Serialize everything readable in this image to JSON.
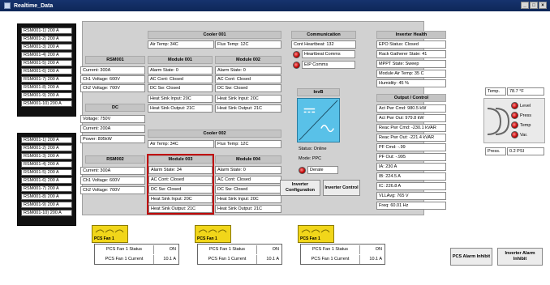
{
  "window": {
    "title": "Realtime_Data",
    "minimize": "_",
    "maximize": "□",
    "close": "×"
  },
  "rsm_group_a": [
    "RSM001-1)  200 A",
    "RSM001-2)  200 A",
    "RSM001-3)  200 A",
    "RSM001-4)  200 A",
    "RSM001-5)  200 A",
    "RSM001-6)  200 A",
    "RSM001-7)  200 A",
    "RSM001-8)  200 A",
    "RSM001-9)  200 A",
    "RSM001-10)  200 A"
  ],
  "rsm_group_b": [
    "RSM001-1)  200 A",
    "RSM001-2)  200 A",
    "RSM001-3)  200 A",
    "RSM001-4)  200 A",
    "RSM001-5)  200 A",
    "RSM001-6)  200 A",
    "RSM001-7)  200 A",
    "RSM001-8)  200 A",
    "RSM001-9)  200 A",
    "RSM001-10)  200 A"
  ],
  "rsm001": {
    "title": "RSM001",
    "current": "Current: 300A",
    "ch1": "Ch1 Voltage: 600V",
    "ch2": "Ch2 Voltage: 700V"
  },
  "dc": {
    "title": "DC",
    "voltage": "Voltage: 750V",
    "current": "Current: 200A",
    "power": "Power: 895kW"
  },
  "rsm002": {
    "title": "RSM002",
    "current": "Current: 300A",
    "ch1": "Ch1 Voltage: 600V",
    "ch2": "Ch2 Voltage: 700V"
  },
  "cooler001": {
    "title": "Cooler 001",
    "air": "Air Temp: 34C",
    "flux": "Flux Temp: 12C"
  },
  "cooler002": {
    "title": "Cooler 002",
    "air": "Air Temp: 34C",
    "flux": "Flux Temp: 12C"
  },
  "module001": {
    "title": "Module 001",
    "alarm": "Alarm State: 0",
    "ac": "AC Cont: Closed",
    "dc": "DC Sw: Closed",
    "hs_in": "Heat Sink Input: 20C",
    "hs_out": "Heat Sink Output: 21C"
  },
  "module002": {
    "title": "Module 002",
    "alarm": "Alarm State: 0",
    "ac": "AC Cont: Closed",
    "dc": "DC Sw: Closed",
    "hs_in": "Heat Sink Input: 20C",
    "hs_out": "Heat Sink Output: 21C"
  },
  "module003": {
    "title": "Module 003",
    "alarm": "Alarm State: 34",
    "ac": "AC Cont: Closed",
    "dc": "DC Sw: Closed",
    "hs_in": "Heat Sink Input: 20C",
    "hs_out": "Heat Sink Output: 21C"
  },
  "module004": {
    "title": "Module 004",
    "alarm": "Alarm State: 0",
    "ac": "AC Cont: Closed",
    "dc": "DC Sw: Closed",
    "hs_in": "Heat Sink Input: 20C",
    "hs_out": "Heat Sink Output: 21C"
  },
  "communication": {
    "title": "Communication",
    "heartbeat": "Cont Heartbeat: 132",
    "hb_comms": "Heartbeat Comms",
    "eip_comms": "EIP Comms"
  },
  "invb": {
    "title": "InvB",
    "status": "Status: Online",
    "mode": "Mode: PPC",
    "derate": "Derate"
  },
  "buttons": {
    "inv_config": "Inverter Configuration",
    "inv_control": "Inverter Control",
    "pcs_alarm": "PCS Alarm Inhibit",
    "inv_alarm": "Inverter Alarm Inhibit"
  },
  "inverter_health": {
    "title": "Inverter Health",
    "epo": "EPO Status: Closed",
    "rack": "Rack Gatherer State: 41",
    "mppt": "MPPT State: Sweep",
    "module_air": "Module Air Temp: 35 C",
    "humidity": "Humidity: 45 %"
  },
  "output_control": {
    "title": "Output / Control",
    "rows": [
      "Act Pwr Cmd: 980.5 kW",
      "Act Pwr Out: 979.8 kW",
      "Reac Pwr Cmd: -230.1 kVAR",
      "Reac Pwr Out: -221.4 kVAR",
      "PF Cmd: -.99",
      "PF Out: -.995",
      "IA: 230 A",
      "IB: 224.5 A",
      "IC: 226.8 A",
      "VLLAvg: 765 V",
      "Freq: 60.01 Hz"
    ]
  },
  "sensor": {
    "temp_label": "Temp.",
    "temp_value": "78.7  °F",
    "press_label": "Press.",
    "press_value": "0.2  PSI",
    "leds": [
      "Level",
      "Press",
      "Temp",
      "Var."
    ]
  },
  "fans": [
    {
      "label": "PCS Fan 1",
      "status_label": "PCS Fan 1 Status",
      "status_value": "ON",
      "current_label": "PCS Fan 1 Current",
      "current_value": "10.1 A"
    },
    {
      "label": "PCS Fan 1",
      "status_label": "PCS Fan 1 Status",
      "status_value": "ON",
      "current_label": "PCS Fan 1 Current",
      "current_value": "10.1 A"
    },
    {
      "label": "PCS Fan 1",
      "status_label": "PCS Fan 1 Status",
      "status_value": "ON",
      "current_label": "PCS Fan 1 Current",
      "current_value": "10.1 A"
    }
  ],
  "colors": {
    "title_bar": "#16336e",
    "panel_bg": "#d1d1d1",
    "alarm_red": "#c00000",
    "fan_yellow": "#f1d61a",
    "invb_blue": "#59c1e8"
  }
}
